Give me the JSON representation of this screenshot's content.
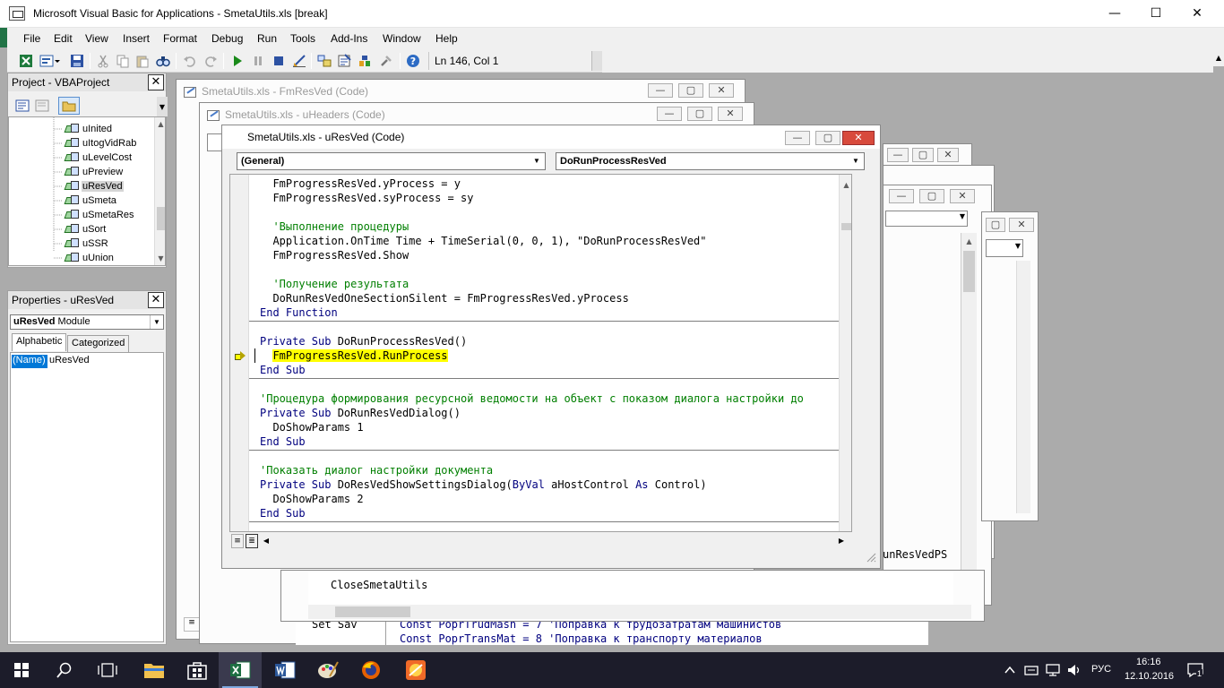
{
  "app": {
    "title": "Microsoft Visual Basic for Applications - SmetaUtils.xls [break]",
    "minimize": "—",
    "maximize": "☐",
    "close": "✕"
  },
  "menu": [
    "File",
    "Edit",
    "View",
    "Insert",
    "Format",
    "Debug",
    "Run",
    "Tools",
    "Add-Ins",
    "Window",
    "Help"
  ],
  "toolbar": {
    "cursor_position": "Ln 146, Col 1",
    "icons": [
      "view-excel-icon",
      "insert-module-icon",
      "save-icon",
      "cut-icon",
      "copy-icon",
      "paste-icon",
      "find-icon",
      "undo-icon",
      "redo-icon",
      "run-icon",
      "break-icon",
      "reset-icon",
      "design-mode-icon",
      "project-explorer-icon",
      "properties-icon",
      "object-browser-icon",
      "toolbox-icon",
      "help-icon"
    ]
  },
  "project_pane": {
    "title": "Project - VBAProject",
    "items": [
      "uInited",
      "uItogVidRab",
      "uLevelCost",
      "uPreview",
      "uResVed",
      "uSmeta",
      "uSmetaRes",
      "uSort",
      "uSSR",
      "uUnion"
    ],
    "selected": "uResVed"
  },
  "properties_pane": {
    "title": "Properties - uResVed",
    "object_name": "uResVed",
    "object_type": "Module",
    "tabs": [
      "Alphabetic",
      "Categorized"
    ],
    "prop_name": "(Name)",
    "prop_value": "uResVed"
  },
  "windows": {
    "fmresved": "SmetaUtils.xls - FmResVed (Code)",
    "uheaders": "SmetaUtils.xls - uHeaders (Code)",
    "active": "SmetaUtils.xls - uResVed (Code)",
    "object_combo": "(General)",
    "proc_combo": "DoRunProcessResVed"
  },
  "code": {
    "l1": "  FmProgressResVed.yProcess = y",
    "l2": "  FmProgressResVed.syProcess = sy",
    "l3": "  'Выполнение процедуры",
    "l4": "  Application.OnTime Time + TimeSerial(0, 0, 1), \"DoRunProcessResVed\"",
    "l5": "  FmProgressResVed.Show",
    "l6": "  'Получение результата",
    "l7": "  DoRunResVedOneSectionSilent = FmProgressResVed.yProcess",
    "l8_kw": "End Function",
    "l9_kw": "Private Sub",
    "l9_rest": " DoRunProcessResVed()",
    "l10": "FmProgressResVed.RunProcess",
    "l11_kw": "End Sub",
    "l12": "'Процедура формирования ресурсной ведомости на объект с показом диалога настройки до",
    "l13_kw": "Private Sub",
    "l13_rest": " DoRunResVedDialog()",
    "l14": "  DoShowParams 1",
    "l15_kw": "End Sub",
    "l16": "'Показать диалог настройки документа",
    "l17_kw": "Private Sub",
    "l17_rest": " DoResVedShowSettingsDialog(",
    "l17_kw2": "ByVal",
    "l17_rest2": " aHostControl ",
    "l17_kw3": "As",
    "l17_rest3": " Control)",
    "l18": "  DoShowParams 2",
    "l19_kw": "End Sub"
  },
  "background_code": {
    "b1": "unResVedPS",
    "b2": "CloseSmetaUtils",
    "b3": "Set Sav",
    "b4": "Const PoprTrudMash = 7 'Поправка к трудозатратам машинистов",
    "b5": "Const PoprTransMat = 8 'Поправка к транспорту материалов"
  },
  "taskbar": {
    "language": "РУС",
    "time": "16:16",
    "date": "12.10.2016",
    "notifications": "1"
  }
}
